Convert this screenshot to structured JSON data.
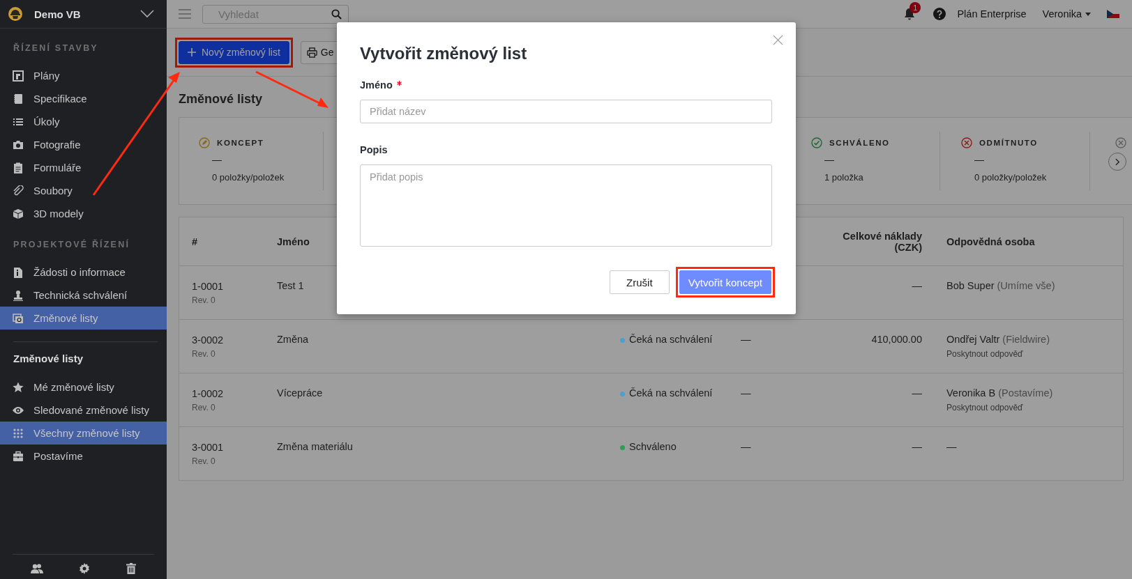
{
  "sidebar": {
    "project": {
      "name": "Demo VB"
    },
    "sections": [
      {
        "title": "ŘÍZENÍ STAVBY",
        "kind": "caps",
        "items": [
          {
            "label": "Plány",
            "selected": false
          },
          {
            "label": "Specifikace",
            "selected": false
          },
          {
            "label": "Úkoly",
            "selected": false
          },
          {
            "label": "Fotografie",
            "selected": false
          },
          {
            "label": "Formuláře",
            "selected": false
          },
          {
            "label": "Soubory",
            "selected": false
          },
          {
            "label": "3D modely",
            "selected": false
          }
        ]
      },
      {
        "title": "PROJEKTOVÉ ŘÍZENÍ",
        "kind": "caps",
        "items": [
          {
            "label": "Žádosti o informace",
            "selected": false
          },
          {
            "label": "Technická schválení",
            "selected": false
          },
          {
            "label": "Změnové listy",
            "selected": true
          }
        ]
      },
      {
        "title": "Změnové listy",
        "kind": "heading",
        "items": [
          {
            "label": "Mé změnové listy",
            "selected": false
          },
          {
            "label": "Sledované změnové listy",
            "selected": false
          },
          {
            "label": "Všechny změnové listy",
            "selected": true
          },
          {
            "label": "Postavíme",
            "selected": false
          }
        ]
      }
    ]
  },
  "topbar": {
    "search": {
      "placeholder": "Vyhledat"
    },
    "notification_count": "1",
    "plan": "Plán Enterprise",
    "user": "Veronika"
  },
  "toolbar": {
    "buttons": [
      {
        "label": "Nový změnový list",
        "kind": "primary",
        "highlighted": true
      },
      {
        "label": "Ge",
        "kind": "print",
        "highlighted": false
      }
    ]
  },
  "page_title": "Změnové listy",
  "stats": [
    {
      "label": "KONCEPT",
      "kind": "draft",
      "value": "—",
      "count": "0 položky/položek"
    },
    {
      "label": "SCHVÁLENO",
      "kind": "approved",
      "value": "—",
      "count": "1 položka"
    },
    {
      "label": "ODMÍTNUTO",
      "kind": "rejected",
      "value": "—",
      "count": "0 položky/položek"
    }
  ],
  "table": {
    "columns": [
      "#",
      "Jméno",
      "Celkové náklady (CZK)",
      "Odpovědná osoba"
    ],
    "rows": [
      {
        "number": "1-0001",
        "revision": "Rev. 0",
        "name": "Test 1",
        "cost": "—",
        "person": "Bob Super",
        "company": "(Umíme vše)"
      },
      {
        "number": "3-0002",
        "revision": "Rev. 0",
        "name": "Změna",
        "status": {
          "text": "Čeká na schválení",
          "color": "#4a9fd4"
        },
        "column_5": "—",
        "cost": "410,000.00",
        "person": "Ondřej Valtr",
        "company": "(Fieldwire)",
        "note": "Poskytnout odpověď"
      },
      {
        "number": "1-0002",
        "revision": "Rev. 0",
        "name": "Vícepráce",
        "status": {
          "text": "Čeká na schválení",
          "color": "#4a9fd4"
        },
        "column_5": "—",
        "cost": "—",
        "person": "Veronika B",
        "company": "(Postavíme)",
        "note": "Poskytnout odpověď"
      },
      {
        "number": "3-0001",
        "revision": "Rev. 0",
        "name": "Změna materiálu",
        "status": {
          "text": "Schváleno",
          "color": "#2e9e4e"
        },
        "column_5": "—",
        "cost": "—",
        "person": "—"
      }
    ]
  },
  "modal": {
    "title": "Vytvořit změnový list",
    "fields": [
      {
        "label": "Jméno",
        "required": true,
        "kind": "input",
        "placeholder": "Přidat název"
      },
      {
        "label": "Popis",
        "required": false,
        "kind": "textarea",
        "placeholder": "Přidat popis"
      }
    ],
    "buttons": [
      {
        "label": "Zrušit",
        "kind": "secondary",
        "highlighted": false
      },
      {
        "label": "Vytvořit koncept",
        "kind": "primary",
        "highlighted": true
      }
    ]
  }
}
